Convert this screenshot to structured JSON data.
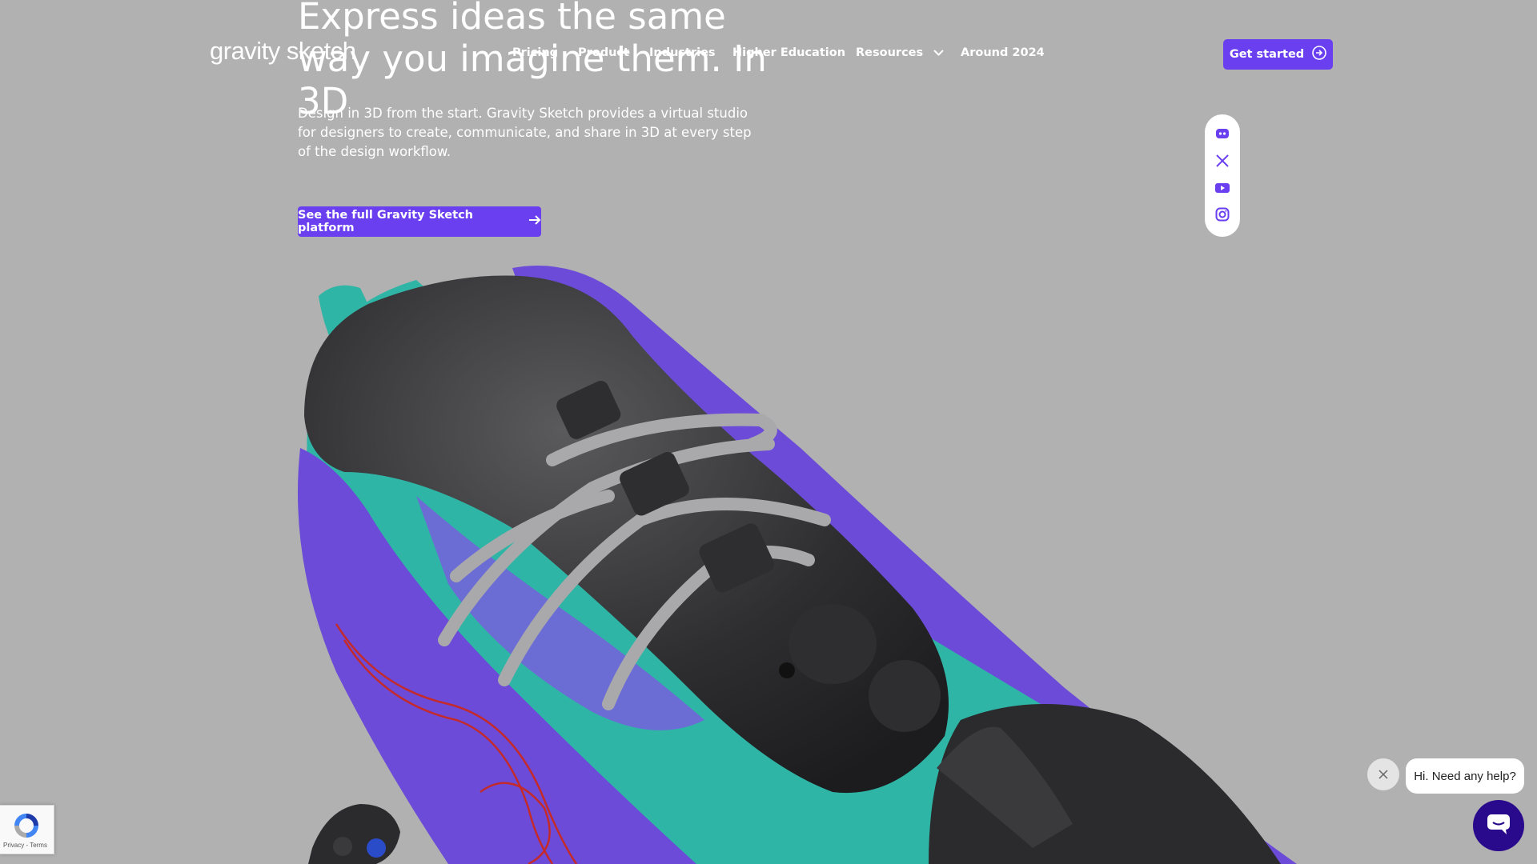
{
  "header": {
    "logo_text": "gravity sketch",
    "nav": [
      {
        "label": "Pricing",
        "has_dropdown": false
      },
      {
        "label": "Product",
        "has_dropdown": true
      },
      {
        "label": "Industries",
        "has_dropdown": true
      },
      {
        "label": "Higher Education",
        "has_dropdown": false
      },
      {
        "label": "Resources",
        "has_dropdown": true
      },
      {
        "label": "Around 2024",
        "has_dropdown": false
      }
    ],
    "cta_label": "Get started"
  },
  "hero": {
    "title": "Express ideas the same way you imagine them. In 3D",
    "description": "Design in 3D from the start. Gravity Sketch provides a virtual studio for designers to create, communicate, and share in 3D at every step of the design workflow.",
    "cta_label": "See the full Gravity Sketch platform"
  },
  "social": {
    "icons": [
      "discord-icon",
      "x-twitter-icon",
      "youtube-icon",
      "instagram-icon"
    ]
  },
  "recaptcha": {
    "links": "Privacy - Terms"
  },
  "chat": {
    "greeting": "Hi. Need any help?"
  },
  "colors": {
    "background": "#b1b1b1",
    "accent": "#6a3ff0",
    "chat_launcher": "#2a0a8c",
    "shoe_teal": "#2fb5a6",
    "shoe_purple": "#6b4bd8",
    "shoe_dark": "#2b2b2d"
  }
}
